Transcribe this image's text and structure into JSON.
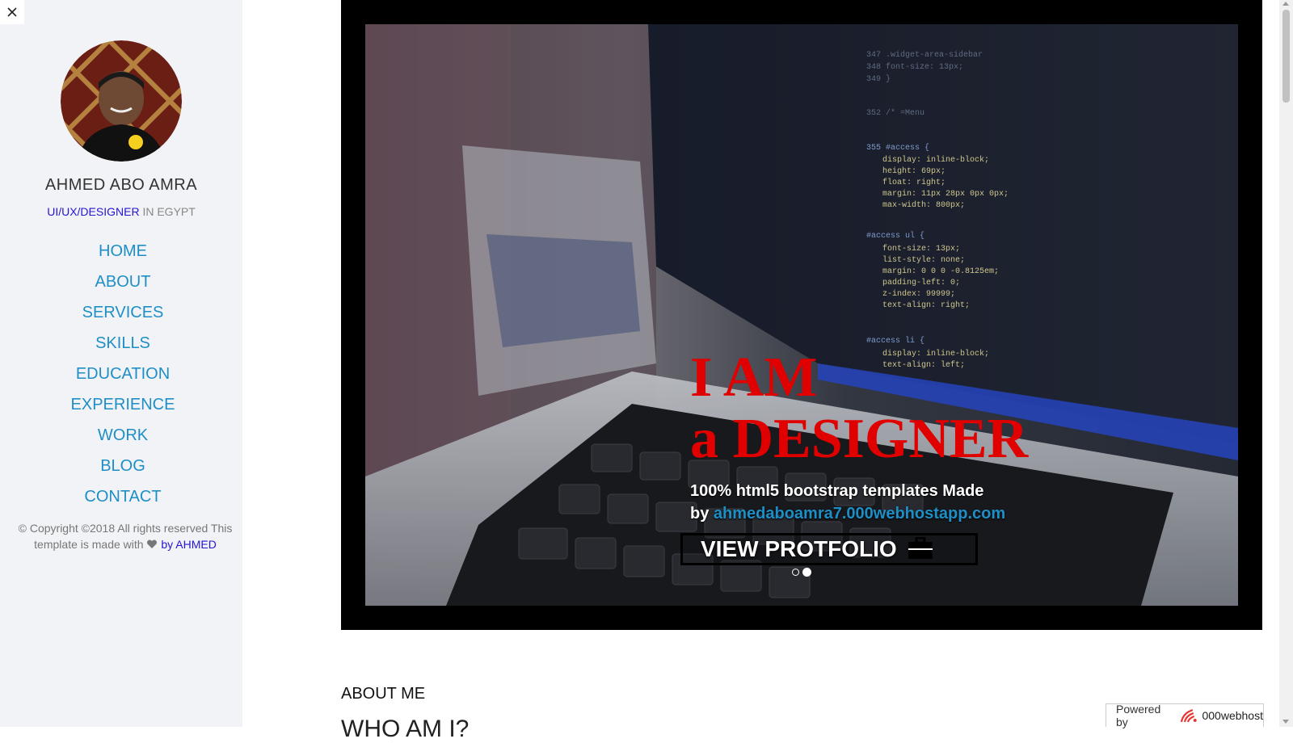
{
  "sidebar": {
    "close_icon": "close-icon",
    "profile": {
      "name": "AHMED ABO AMRA",
      "role_link": "UI/UX/DESIGNER",
      "role_suffix": " IN EGYPT"
    },
    "nav": [
      "HOME",
      "ABOUT",
      "SERVICES",
      "SKILLS",
      "EDUCATION",
      "EXPERIENCE",
      "WORK",
      "BLOG",
      "CONTACT"
    ],
    "copyright": {
      "text": "© Copyright ©2018 All rights reserved This template is made with ",
      "heart_icon": "heart-icon",
      "by_link": " by AHMED"
    }
  },
  "hero": {
    "title_line1": "I AM",
    "title_line2": "a DESIGNER",
    "subtitle": "100% html5 bootstrap templates Made",
    "by_prefix": "by ",
    "by_link": "ahmedaboamra7.000webhostapp.com",
    "button_label": "VIEW PROTFOLIO",
    "button_icon": "briefcase-icon",
    "active_slide": 2,
    "slide_count": 2
  },
  "about": {
    "heading": "ABOUT ME",
    "subheading": "WHO AM I?"
  },
  "badge": {
    "powered_label": "Powered by",
    "brand": "000webhost"
  },
  "colors": {
    "link_blue": "#1e8fc6",
    "accent_link": "#2415d3",
    "hero_title_red": "#e00000",
    "sidebar_bg": "#f2f3f7"
  }
}
